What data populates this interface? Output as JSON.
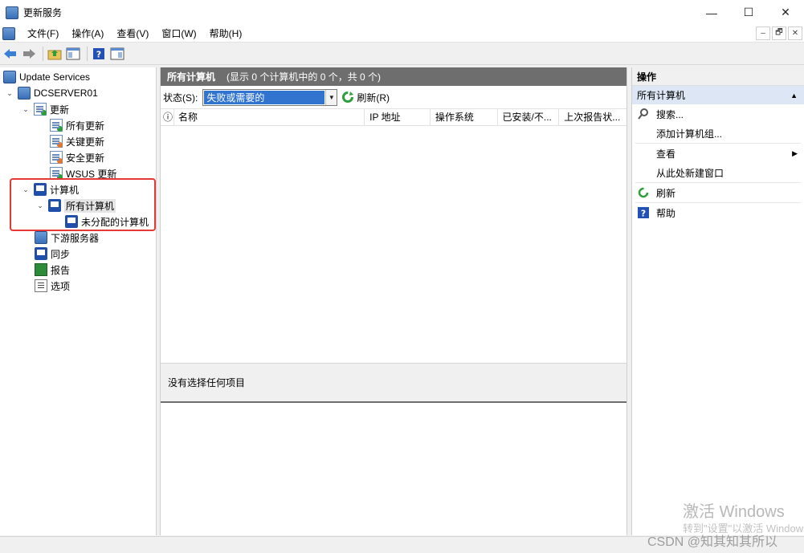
{
  "window": {
    "title": "更新服务",
    "minimize": "—",
    "maximize": "☐",
    "close": "✕"
  },
  "menu": [
    "文件(F)",
    "操作(A)",
    "查看(V)",
    "窗口(W)",
    "帮助(H)"
  ],
  "mdi": {
    "min": "–",
    "restore": "🗗",
    "close": "✕"
  },
  "toolbar": [
    "back-icon",
    "forward-icon",
    "up-folder-icon",
    "show-hide-tree-icon",
    "help-icon",
    "action-pane-icon"
  ],
  "tree": {
    "root": "Update Services",
    "server": "DCSERVER01",
    "updates": "更新",
    "all_updates": "所有更新",
    "critical_updates": "关键更新",
    "security_updates": "安全更新",
    "wsus_updates": "WSUS 更新",
    "computers": "计算机",
    "all_computers": "所有计算机",
    "unassigned_computers": "未分配的计算机",
    "downstream_servers": "下游服务器",
    "synchronizations": "同步",
    "reports": "报告",
    "options": "选项"
  },
  "main": {
    "header_title": "所有计算机",
    "header_subtitle": "(显示 0 个计算机中的 0 个，共 0 个)",
    "status_label": "状态(S):",
    "status_value": "失败或需要的",
    "refresh": "刷新(R)",
    "columns": [
      "ⓘ",
      "名称",
      "IP 地址",
      "操作系统",
      "已安装/不...",
      "上次报告状..."
    ],
    "detail_text": "没有选择任何项目"
  },
  "actions": {
    "header": "操作",
    "section": "所有计算机",
    "items": {
      "search": "搜索...",
      "add_group": "添加计算机组...",
      "view": "查看",
      "new_window": "从此处新建窗口",
      "refresh": "刷新",
      "help": "帮助"
    }
  },
  "watermark": {
    "activate": "激活 Windows",
    "activate_sub": "转到\"设置\"以激活 Windows。",
    "csdn": "CSDN @知其知其所以"
  }
}
